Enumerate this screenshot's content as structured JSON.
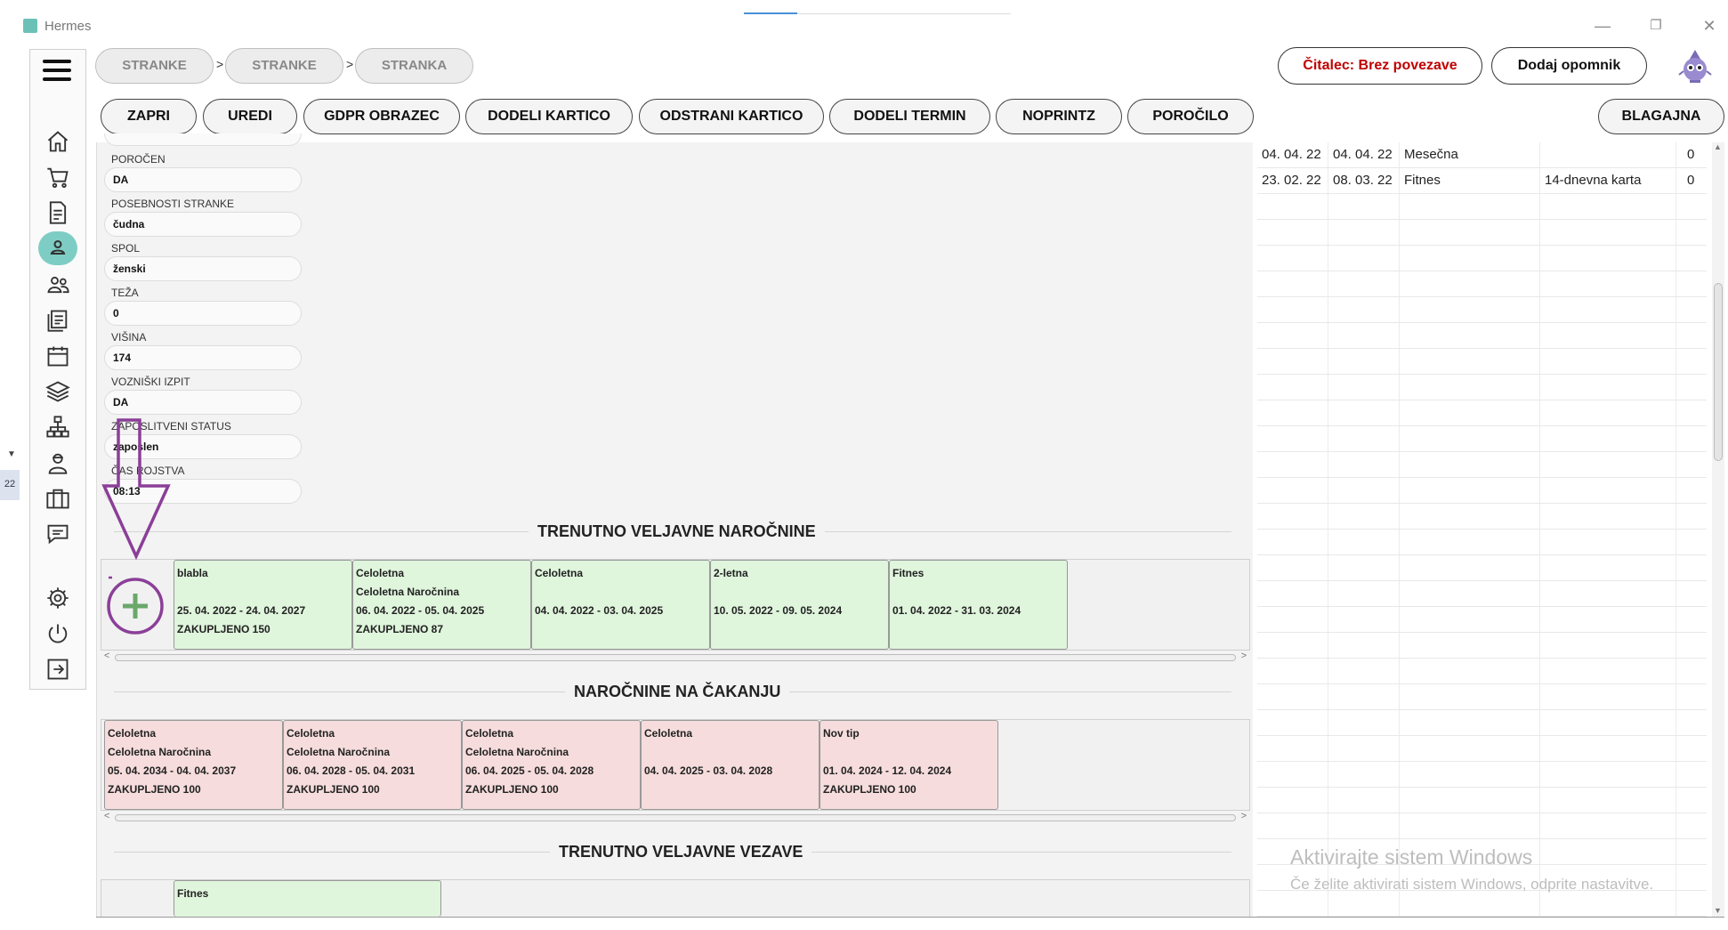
{
  "window": {
    "title": "Hermes",
    "controls": [
      "minimize",
      "restore",
      "close"
    ]
  },
  "left_strip": {
    "date_fragment": "22"
  },
  "breadcrumb": [
    "STRANKE",
    "STRANKE",
    "STRANKA"
  ],
  "breadcrumb_separator": ">",
  "header": {
    "reader_status": "Čitalec: Brez povezave",
    "reader_status_color": "#c00000",
    "add_reminder": "Dodaj opomnik"
  },
  "actions": [
    "ZAPRI",
    "UREDI",
    "GDPR OBRAZEC",
    "DODELI KARTICO",
    "ODSTRANI KARTICO",
    "DODELI TERMIN",
    "NOPRINTZ",
    "POROČILO"
  ],
  "cash_register": "BLAGAJNA",
  "sidebar": {
    "icons": [
      "home-icon",
      "cart-icon",
      "document-icon",
      "user-icon",
      "users-icon",
      "list-icon",
      "calendar-icon",
      "layers-icon",
      "network-icon",
      "worker-icon",
      "briefcase-icon",
      "chat-icon",
      "gear-icon",
      "power-icon",
      "logout-icon"
    ],
    "active": "user-icon",
    "active_color": "#7ecdc4"
  },
  "fields": [
    {
      "label": "POROČEN",
      "value": "DA"
    },
    {
      "label": "POSEBNOSTI STRANKE",
      "value": "čudna"
    },
    {
      "label": "SPOL",
      "value": "ženski"
    },
    {
      "label": "TEŽA",
      "value": "0"
    },
    {
      "label": "VIŠINA",
      "value": "174"
    },
    {
      "label": "VOZNIŠKI IZPIT",
      "value": "DA"
    },
    {
      "label": "ZAPOSLITVENI STATUS",
      "value": "zaposlen"
    },
    {
      "label": "ČAS ROJSTVA",
      "value": "08:13"
    }
  ],
  "sections": {
    "current": "TRENUTNO VELJAVNE NAROČNINE",
    "waiting": "NAROČNINE NA ČAKANJU",
    "links": "TRENUTNO VELJAVNE VEZAVE"
  },
  "current_subscriptions": [
    {
      "title": "blabla",
      "subtitle": "",
      "period": "25. 04. 2022 - 24. 04. 2027",
      "reserved": "ZAKUPLJENO 150"
    },
    {
      "title": "Celoletna",
      "subtitle": "Celoletna Naročnina",
      "period": "06. 04. 2022 - 05. 04. 2025",
      "reserved": "ZAKUPLJENO 87"
    },
    {
      "title": "Celoletna",
      "subtitle": "",
      "period": "04. 04. 2022 - 03. 04. 2025",
      "reserved": ""
    },
    {
      "title": "2-letna",
      "subtitle": "",
      "period": "10. 05. 2022 - 09. 05. 2024",
      "reserved": ""
    },
    {
      "title": "Fitnes",
      "subtitle": "",
      "period": "01. 04. 2022 - 31. 03. 2024",
      "reserved": ""
    }
  ],
  "waiting_subscriptions": [
    {
      "title": "Celoletna",
      "subtitle": "Celoletna Naročnina",
      "period": "05. 04. 2034 - 04. 04. 2037",
      "reserved": "ZAKUPLJENO 100"
    },
    {
      "title": "Celoletna",
      "subtitle": "Celoletna Naročnina",
      "period": "06. 04. 2028 - 05. 04. 2031",
      "reserved": "ZAKUPLJENO 100"
    },
    {
      "title": "Celoletna",
      "subtitle": "Celoletna Naročnina",
      "period": "06. 04. 2025 - 05. 04. 2028",
      "reserved": "ZAKUPLJENO 100"
    },
    {
      "title": "Celoletna",
      "subtitle": "",
      "period": "04. 04. 2025 - 03. 04. 2028",
      "reserved": ""
    },
    {
      "title": "Nov tip",
      "subtitle": "",
      "period": "01. 04. 2024 - 12. 04. 2024",
      "reserved": "ZAKUPLJENO 100"
    }
  ],
  "links": [
    {
      "title": "Fitnes"
    }
  ],
  "history_table": [
    [
      "04. 04. 22",
      "04. 04. 22",
      "Mesečna",
      "",
      "0"
    ],
    [
      "23. 02. 22",
      "08. 03. 22",
      "Fitnes",
      "14-dnevna karta",
      "0"
    ]
  ],
  "annotation": {
    "color": "#8b3f98",
    "shape": "arrow-and-circle"
  },
  "watermark": {
    "title": "Aktivirajte sistem Windows",
    "subtitle": "Če želite aktivirati sistem Windows, odprite nastavitve."
  }
}
